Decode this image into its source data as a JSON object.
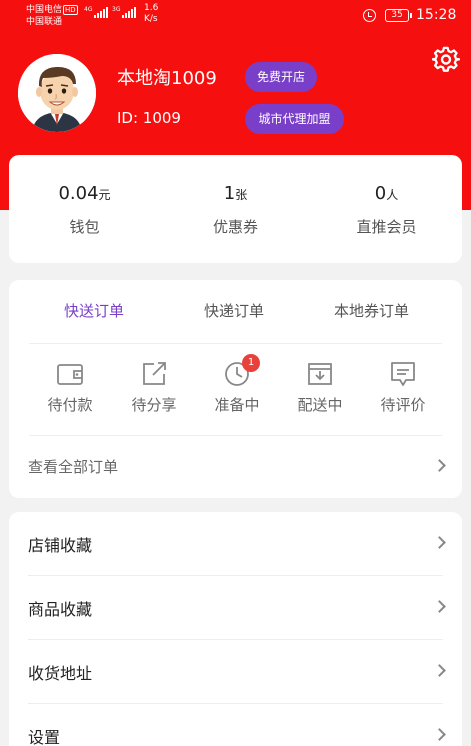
{
  "status_bar": {
    "carrier1": "中国电信",
    "carrier1_badge": "HD",
    "carrier2": "中国联通",
    "net1": "4G",
    "net2": "3G",
    "speed_value": "1.6",
    "speed_unit": "K/s",
    "battery": "35",
    "time": "15:28"
  },
  "profile": {
    "username": "本地淘1009",
    "user_id": "ID: 1009",
    "open_store_label": "免费开店",
    "city_agent_label": "城市代理加盟"
  },
  "stats": [
    {
      "value": "0.04",
      "unit": "元",
      "label": "钱包"
    },
    {
      "value": "1",
      "unit": "张",
      "label": "优惠券"
    },
    {
      "value": "0",
      "unit": "人",
      "label": "直推会员"
    }
  ],
  "orders": {
    "tabs": [
      "快送订单",
      "快递订单",
      "本地券订单"
    ],
    "active_tab": 0,
    "statuses": [
      {
        "label": "待付款",
        "icon": "wallet-icon"
      },
      {
        "label": "待分享",
        "icon": "share-icon"
      },
      {
        "label": "准备中",
        "icon": "clock-icon",
        "badge": "1"
      },
      {
        "label": "配送中",
        "icon": "box-icon"
      },
      {
        "label": "待评价",
        "icon": "comment-icon"
      }
    ],
    "view_all": "查看全部订单"
  },
  "menu": [
    "店铺收藏",
    "商品收藏",
    "收货地址",
    "设置"
  ],
  "colors": {
    "header_red": "#f50f0f",
    "accent_purple": "#7a3fc9",
    "badge_red": "#e8403a"
  }
}
